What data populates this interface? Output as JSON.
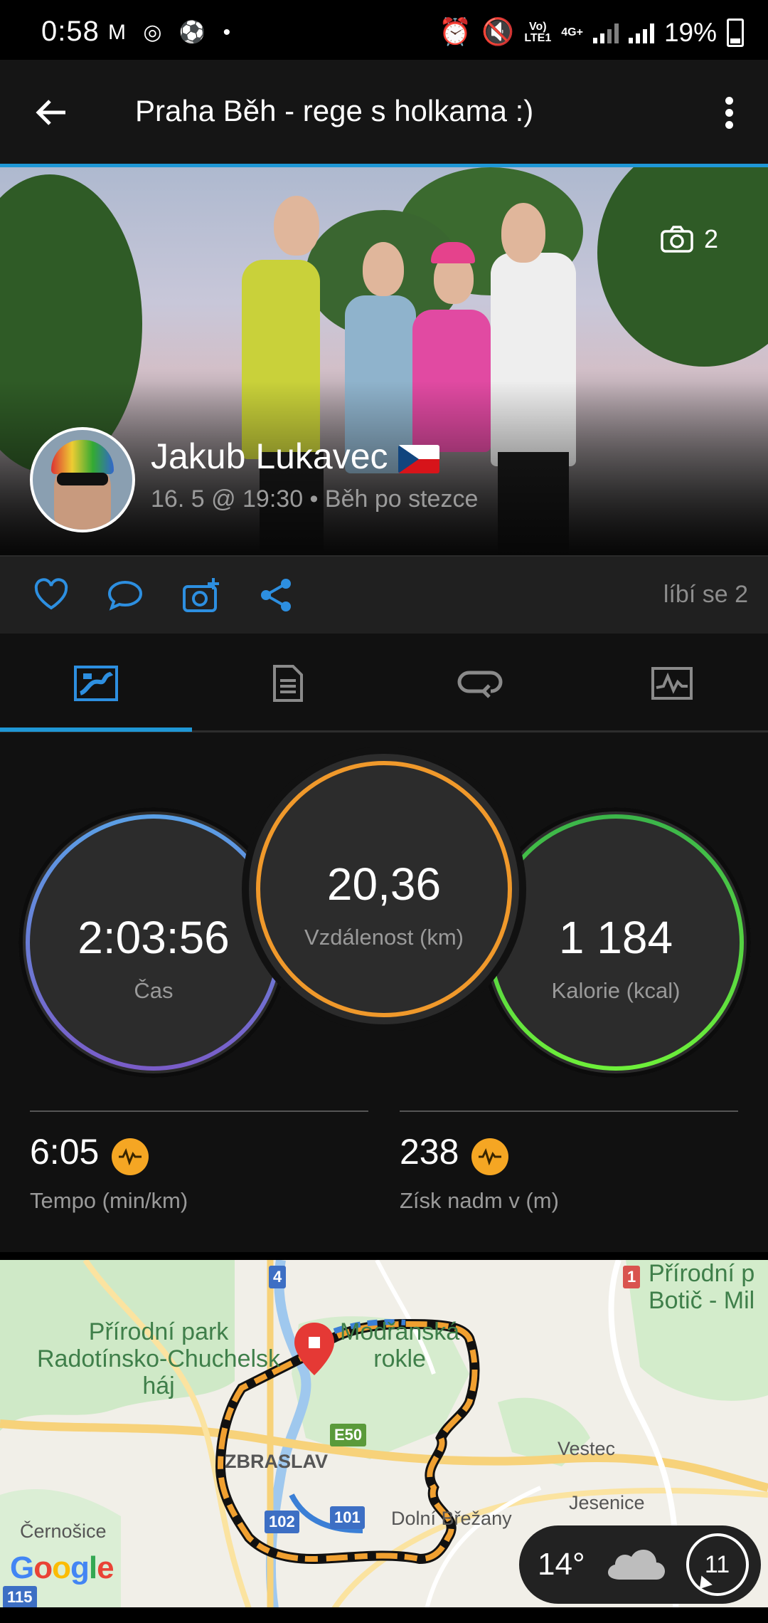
{
  "status_bar": {
    "time": "0:58",
    "battery": "19%",
    "network_top": "Vo)",
    "network_bottom": "LTE1",
    "network_4g": "4G+"
  },
  "app_bar": {
    "title": "Praha Běh - rege s holkama :)"
  },
  "hero": {
    "photo_count": "2",
    "user_name": "Jakub Lukavec",
    "activity_meta": "16. 5 @ 19:30 • Běh po stezce"
  },
  "actions": {
    "likes_text": "líbí se 2"
  },
  "tabs": [
    "overview",
    "details",
    "laps",
    "charts"
  ],
  "stats": {
    "time": {
      "value": "2:03:56",
      "label": "Čas"
    },
    "distance": {
      "value": "20,36",
      "label": "Vzdálenost (km)"
    },
    "calories": {
      "value": "1 184",
      "label": "Kalorie (kcal)"
    },
    "pace": {
      "value": "6:05",
      "label": "Tempo (min/km)"
    },
    "elevation": {
      "value": "238",
      "label": "Získ nadm v (m)"
    }
  },
  "map": {
    "labels": {
      "park1": "Přírodní park\nRadotínsko-Chuchelsk\nháj",
      "modranska": "Modřanská\nrokle",
      "park2": "Přírodní p\nBotič - Mil",
      "zbraslav": "ZBRASLAV",
      "vestec": "Vestec",
      "jesenice": "Jesenice",
      "cernosice": "Černošice",
      "dolni_brezany": "Dolní Břežany"
    },
    "shields": {
      "s4": "4",
      "s1": "1",
      "e50": "E50",
      "s102": "102",
      "s101": "101",
      "s115": "115"
    },
    "weather": {
      "temp": "14°",
      "wind": "11"
    },
    "logo": "Google"
  },
  "colors": {
    "accent": "#1f97d6",
    "time_ring": "#5b8fd6",
    "distance_ring": "#f0992b",
    "calories_ring": "#47c93b",
    "badge": "#f5a623"
  }
}
